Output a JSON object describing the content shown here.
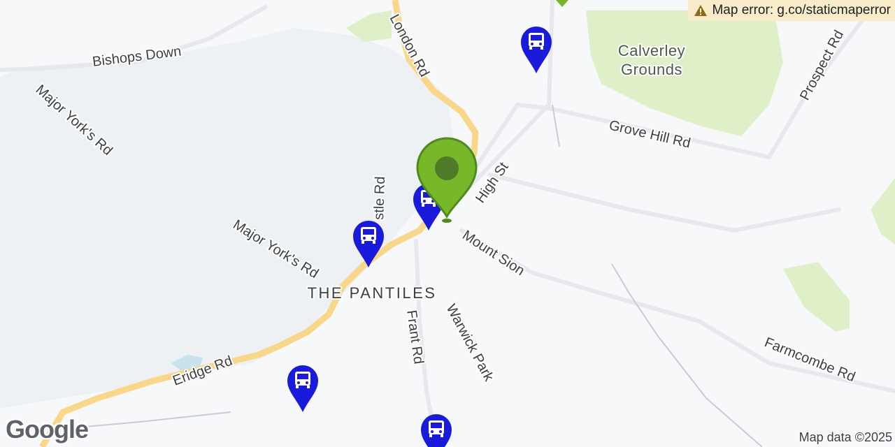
{
  "map": {
    "error_text": "Map error: g.co/staticmaperror",
    "credits": "Map data ©2025",
    "logo": "Google",
    "places": {
      "park": [
        "Calverley",
        "Grounds"
      ],
      "district": "THE PANTILES"
    },
    "roads": {
      "bishops_down": "Bishops Down",
      "london_rd": "London Rd",
      "major_yorks_rd_upper": "Major York's Rd",
      "major_yorks_rd_lower": "Major York's Rd",
      "castle_rd": "stle Rd",
      "high_st": "High St",
      "grove_hill_rd": "Grove Hill Rd",
      "prospect_rd": "Prospect Rd",
      "mount_sion": "Mount Sion",
      "frant_rd": "Frant Rd",
      "warwick_park": "Warwick Park",
      "eridge_rd": "Eridge Rd",
      "farmcombe_rd": "Farmcombe Rd"
    },
    "markers": {
      "main_pin": "location-pin-icon",
      "bus_stop": "bus-stop-icon"
    },
    "colors": {
      "main_pin": "#76b82a",
      "bus_marker": "#1a1adb",
      "major_road": "#f9d78a",
      "park": "#dff0c9",
      "common": "#eef1f4",
      "error_banner": "#f9eccb"
    }
  }
}
